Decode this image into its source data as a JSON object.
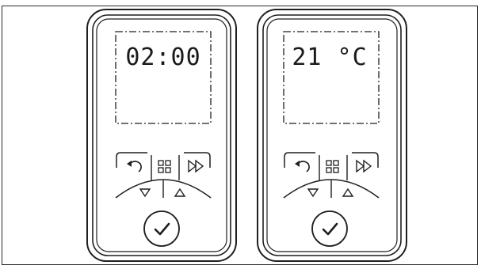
{
  "panels": [
    {
      "display": {
        "text": "02:00"
      },
      "keys": {
        "back": {
          "icon": "back-arrow-icon"
        },
        "menu": {
          "icon": "grid-menu-icon"
        },
        "forward": {
          "icon": "fast-forward-icon"
        },
        "down": {
          "icon": "triangle-down-icon"
        },
        "up": {
          "icon": "triangle-up-icon"
        },
        "confirm": {
          "icon": "checkmark-icon"
        }
      }
    },
    {
      "display": {
        "text": "21 °C"
      },
      "keys": {
        "back": {
          "icon": "back-arrow-icon"
        },
        "menu": {
          "icon": "grid-menu-icon"
        },
        "forward": {
          "icon": "fast-forward-icon"
        },
        "down": {
          "icon": "triangle-down-icon"
        },
        "up": {
          "icon": "triangle-up-icon"
        },
        "confirm": {
          "icon": "checkmark-icon"
        }
      }
    }
  ],
  "colors": {
    "line": "#1f1f1f",
    "background": "#ffffff"
  }
}
